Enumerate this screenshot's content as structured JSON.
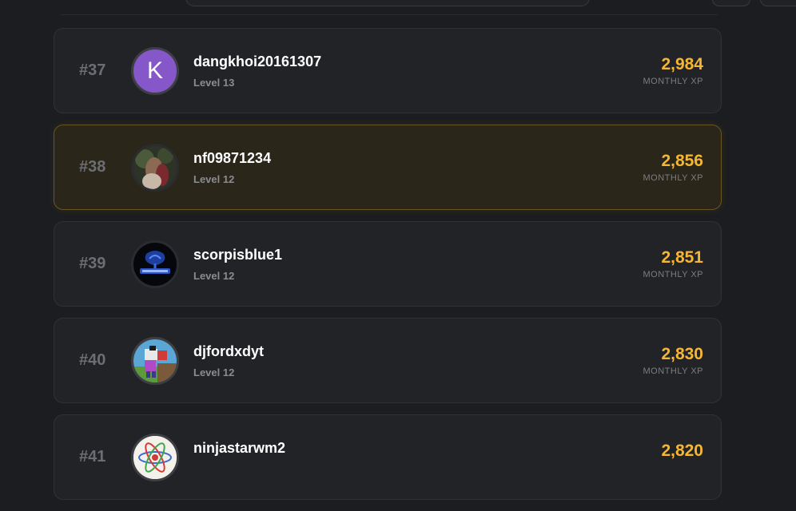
{
  "xp_label": "MONTHLY XP",
  "colors": {
    "xp": "#f5b632",
    "highlight_border": "#6a5624",
    "avatar_letter_bg": "#8557c9"
  },
  "entries": [
    {
      "rank": "#37",
      "username": "dangkhoi20161307",
      "level": "Level 13",
      "xp": "2,984",
      "avatar_letter": "K",
      "avatar": "letter-avatar"
    },
    {
      "rank": "#38",
      "username": "nf09871234",
      "level": "Level 12",
      "xp": "2,856",
      "avatar": "photo-avatar",
      "highlighted": true
    },
    {
      "rank": "#39",
      "username": "scorpisblue1",
      "level": "Level 12",
      "xp": "2,851",
      "avatar": "scorpion-logo-avatar"
    },
    {
      "rank": "#40",
      "username": "djfordxdyt",
      "level": "Level 12",
      "xp": "2,830",
      "avatar": "pixel-game-avatar"
    },
    {
      "rank": "#41",
      "username": "ninjastarwm2",
      "xp": "2,820",
      "avatar": "atom-icon-avatar"
    }
  ]
}
